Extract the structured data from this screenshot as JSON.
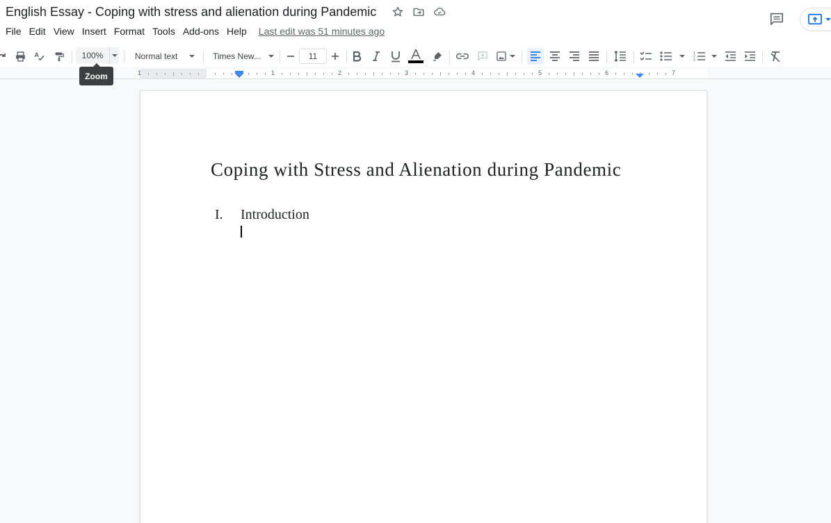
{
  "header": {
    "doc_title": "English Essay - Coping with stress and alienation during Pandemic",
    "menu": [
      "File",
      "Edit",
      "View",
      "Insert",
      "Format",
      "Tools",
      "Add-ons",
      "Help"
    ],
    "last_edit": "Last edit was 51 minutes ago",
    "icons": {
      "star": "star-icon",
      "move": "folder-move-icon",
      "cloud": "cloud-status-icon",
      "comments": "comments-icon",
      "share": "present-icon"
    }
  },
  "toolbar": {
    "zoom": "100%",
    "style": "Normal text",
    "font": "Times New...",
    "font_size": "11",
    "tooltip": "Zoom",
    "text_color": "#000000",
    "accent": "#1a73e8"
  },
  "ruler": {
    "labels": [
      "1",
      "1",
      "2",
      "3",
      "4",
      "5",
      "6",
      "7"
    ]
  },
  "document": {
    "title": "Coping with Stress and Alienation during Pandemic",
    "list": [
      {
        "marker": "I.",
        "text": "Introduction"
      }
    ]
  }
}
